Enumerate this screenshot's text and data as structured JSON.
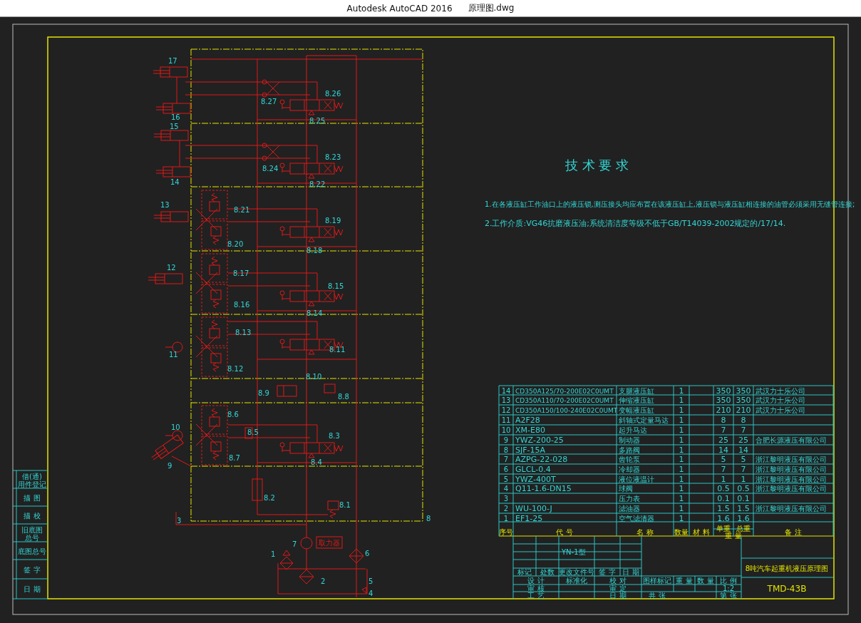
{
  "window": {
    "app": "Autodesk AutoCAD 2016",
    "file": "原理图.dwg"
  },
  "schematic": {
    "labels": [
      "17",
      "16",
      "15",
      "14",
      "8.27",
      "8.26",
      "8.25",
      "8.24",
      "8.23",
      "8.22",
      "13",
      "8.21",
      "8.19",
      "8.20",
      "8.18",
      "12",
      "8.17",
      "8.15",
      "8.16",
      "8.14",
      "11",
      "8.13",
      "8.11",
      "8.12",
      "8.10",
      "8.9",
      "8.8",
      "10",
      "8.6",
      "8.5",
      "8.3",
      "9",
      "8.7",
      "8.4",
      "8.2",
      "8.1",
      "3",
      "8",
      "7",
      "1",
      "6",
      "2",
      "5",
      "4"
    ],
    "pump_box": "取力器"
  },
  "technical_requirements": {
    "heading": "技 术 要 求",
    "items": [
      "1.在各液压缸工作油口上的液压锁,测压接头均应布置在该液压缸上,液压锁与液压缸相连接的油管必须采用无缝管连接;",
      "2.工作介质:VG46抗磨液压油;系统清洁度等级不低于GB/T14039-2002规定的/17/14."
    ]
  },
  "parts_table": {
    "header": [
      "序号",
      "代 号",
      "名 称",
      "数量",
      "材 料",
      "单重",
      "总重",
      "重 量",
      "备 注"
    ],
    "rows": [
      {
        "no": "14",
        "code": "CD350A125/70-200E02C0UMT",
        "name": "支腿液压缸",
        "qty": "1",
        "unit": "350",
        "total": "350",
        "remark": "武汉力士乐公司"
      },
      {
        "no": "13",
        "code": "CD350A110/70-200E02C0UMT",
        "name": "伸缩液压缸",
        "qty": "1",
        "unit": "350",
        "total": "350",
        "remark": "武汉力士乐公司"
      },
      {
        "no": "12",
        "code": "CD350A150/100-240E02C0UMT",
        "name": "变幅液压缸",
        "qty": "1",
        "unit": "210",
        "total": "210",
        "remark": "武汉力士乐公司"
      },
      {
        "no": "11",
        "code": "A2F28",
        "name": "斜轴式定量马达",
        "qty": "1",
        "unit": "8",
        "total": "8"
      },
      {
        "no": "10",
        "code": "XM-E80",
        "name": "起升马达",
        "qty": "1",
        "unit": "7",
        "total": "7"
      },
      {
        "no": "9",
        "code": "YWZ-200-25",
        "name": "制动器",
        "qty": "1",
        "unit": "25",
        "total": "25",
        "remark": "合肥长源液压有限公司"
      },
      {
        "no": "8",
        "code": "SJF-15A",
        "name": "多路阀",
        "qty": "1",
        "unit": "14",
        "total": "14"
      },
      {
        "no": "7",
        "code": "AZPG-22-028",
        "name": "齿轮泵",
        "qty": "1",
        "unit": "5",
        "total": "5",
        "remark": "浙江黎明液压有限公司"
      },
      {
        "no": "6",
        "code": "GLCL-0.4",
        "name": "冷却器",
        "qty": "1",
        "unit": "7",
        "total": "7",
        "remark": "浙江黎明液压有限公司"
      },
      {
        "no": "5",
        "code": "YWZ-400T",
        "name": "液位液温计",
        "qty": "1",
        "unit": "1",
        "total": "1",
        "remark": "浙江黎明液压有限公司"
      },
      {
        "no": "4",
        "code": "Q11-1.6-DN15",
        "name": "球阀",
        "qty": "1",
        "unit": "0.5",
        "total": "0.5",
        "remark": "浙江黎明液压有限公司"
      },
      {
        "no": "3",
        "name": "压力表",
        "qty": "1",
        "unit": "0.1",
        "total": "0.1"
      },
      {
        "no": "2",
        "code": "WU-100-J",
        "name": "滤油器",
        "qty": "1",
        "unit": "1.5",
        "total": "1.5",
        "remark": "浙江黎明液压有限公司"
      },
      {
        "no": "1",
        "code": "EF1-25",
        "name": "空气滤清器",
        "qty": "1",
        "unit": "1.6",
        "total": "1.6"
      }
    ]
  },
  "title_block": {
    "material": "YN-1型",
    "title": "8吨汽车起重机液压原理图",
    "drawing_no": "TMD-43B",
    "scale": "1:2",
    "fields": [
      "标记",
      "处数",
      "更改文件号",
      "签 字",
      "日 期",
      "设 计",
      "标准化",
      "校 对",
      "审 定",
      "审 核",
      "工 艺",
      "日 期",
      "图样标记",
      "重 量",
      "数 量",
      "比 例",
      "共 张",
      "第 张"
    ]
  },
  "revision_strip": {
    "fields": [
      "借(通)用件登记",
      "描 图",
      "描 校",
      "旧底图总号",
      "底图总号",
      "签 字",
      "日 期"
    ]
  }
}
